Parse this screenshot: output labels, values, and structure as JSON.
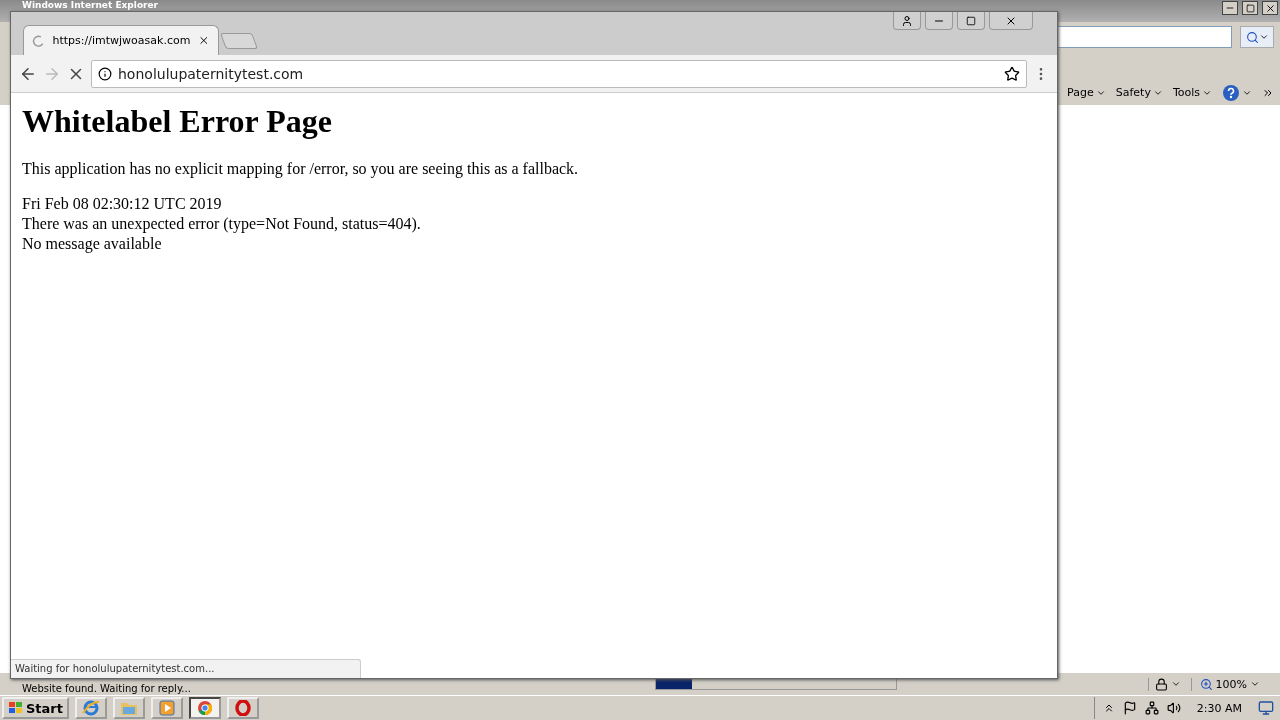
{
  "ie_window": {
    "title": "Windows Internet Explorer",
    "command_bar": [
      "Page",
      "Safety",
      "Tools"
    ],
    "status": "Website found. Waiting for reply...",
    "progress": {
      "level": 0.15
    },
    "zoom": "100%"
  },
  "browser": {
    "tab": {
      "title": "https://imtwjwoasak.com",
      "loading": true
    },
    "address": "honolulupaternitytest.com",
    "page": {
      "heading": "Whitelabel Error Page",
      "paragraph": "This application has no explicit mapping for /error, so you are seeing this as a fallback.",
      "lines": [
        "Fri Feb 08 02:30:12 UTC 2019",
        "There was an unexpected error (type=Not Found, status=404).",
        "No message available"
      ]
    },
    "status_bubble": "Waiting for honolulupaternitytest.com..."
  },
  "taskbar": {
    "start": "Start",
    "apps": [
      {
        "kind": "ie",
        "selected": false
      },
      {
        "kind": "folder",
        "selected": false
      },
      {
        "kind": "media",
        "selected": false
      },
      {
        "kind": "chrome",
        "selected": true
      },
      {
        "kind": "opera",
        "selected": false
      }
    ],
    "clock": "2:30 AM"
  }
}
